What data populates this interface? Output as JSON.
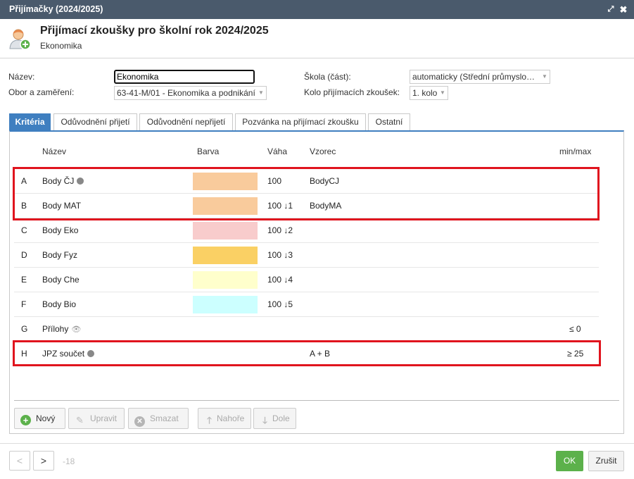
{
  "window": {
    "title": "Přijímačky (2024/2025)"
  },
  "header": {
    "title": "Přijímací zkoušky pro školní rok 2024/2025",
    "subtitle": "Ekonomika"
  },
  "form": {
    "name_label": "Název:",
    "name_value": "Ekonomika",
    "obor_label": "Obor a zaměření:",
    "obor_value": "63-41-M/01 - Ekonomika a podnikání",
    "skola_label": "Škola (část):",
    "skola_value": "automaticky (Střední průmyslo…",
    "kolo_label": "Kolo přijímacích zkoušek:",
    "kolo_value": "1. kolo"
  },
  "tabs": [
    {
      "label": "Kritéria",
      "active": true
    },
    {
      "label": "Odůvodnění přijetí"
    },
    {
      "label": "Odůvodnění nepřijetí"
    },
    {
      "label": "Pozvánka na přijímací zkoušku"
    },
    {
      "label": "Ostatní"
    }
  ],
  "table": {
    "columns": {
      "name": "Název",
      "color": "Barva",
      "weight": "Váha",
      "formula": "Vzorec",
      "minmax": "min/max"
    },
    "rows": [
      {
        "letter": "A",
        "name": "Body ČJ",
        "icon": "globe-icon",
        "color": "#f9cb9c",
        "weight": "100",
        "formula": "BodyCJ",
        "minmax": ""
      },
      {
        "letter": "B",
        "name": "Body MAT",
        "icon": "",
        "color": "#f9cb9c",
        "weight": "100 ↓1",
        "formula": "BodyMA",
        "minmax": ""
      },
      {
        "letter": "C",
        "name": "Body Eko",
        "icon": "",
        "color": "#f8cccc",
        "weight": "100 ↓2",
        "formula": "",
        "minmax": ""
      },
      {
        "letter": "D",
        "name": "Body Fyz",
        "icon": "",
        "color": "#fad064",
        "weight": "100 ↓3",
        "formula": "",
        "minmax": ""
      },
      {
        "letter": "E",
        "name": "Body Che",
        "icon": "",
        "color": "#ffffcc",
        "weight": "100 ↓4",
        "formula": "",
        "minmax": ""
      },
      {
        "letter": "F",
        "name": "Body Bio",
        "icon": "",
        "color": "#ccffff",
        "weight": "100 ↓5",
        "formula": "",
        "minmax": ""
      },
      {
        "letter": "G",
        "name": "Přílohy",
        "icon": "eye-slash-icon",
        "color": "",
        "weight": "",
        "formula": "",
        "minmax": "≤ 0"
      },
      {
        "letter": "H",
        "name": "JPZ součet",
        "icon": "globe-icon",
        "color": "",
        "weight": "",
        "formula": "A + B",
        "minmax": "≥ 25"
      }
    ]
  },
  "toolbar": {
    "new_label": "Nový",
    "edit_label": "Upravit",
    "delete_label": "Smazat",
    "top_label": "Nahoře",
    "down_label": "Dole"
  },
  "footer": {
    "prev": "<",
    "next": ">",
    "counter": "-18",
    "ok_label": "OK",
    "cancel_label": "Zrušit"
  }
}
